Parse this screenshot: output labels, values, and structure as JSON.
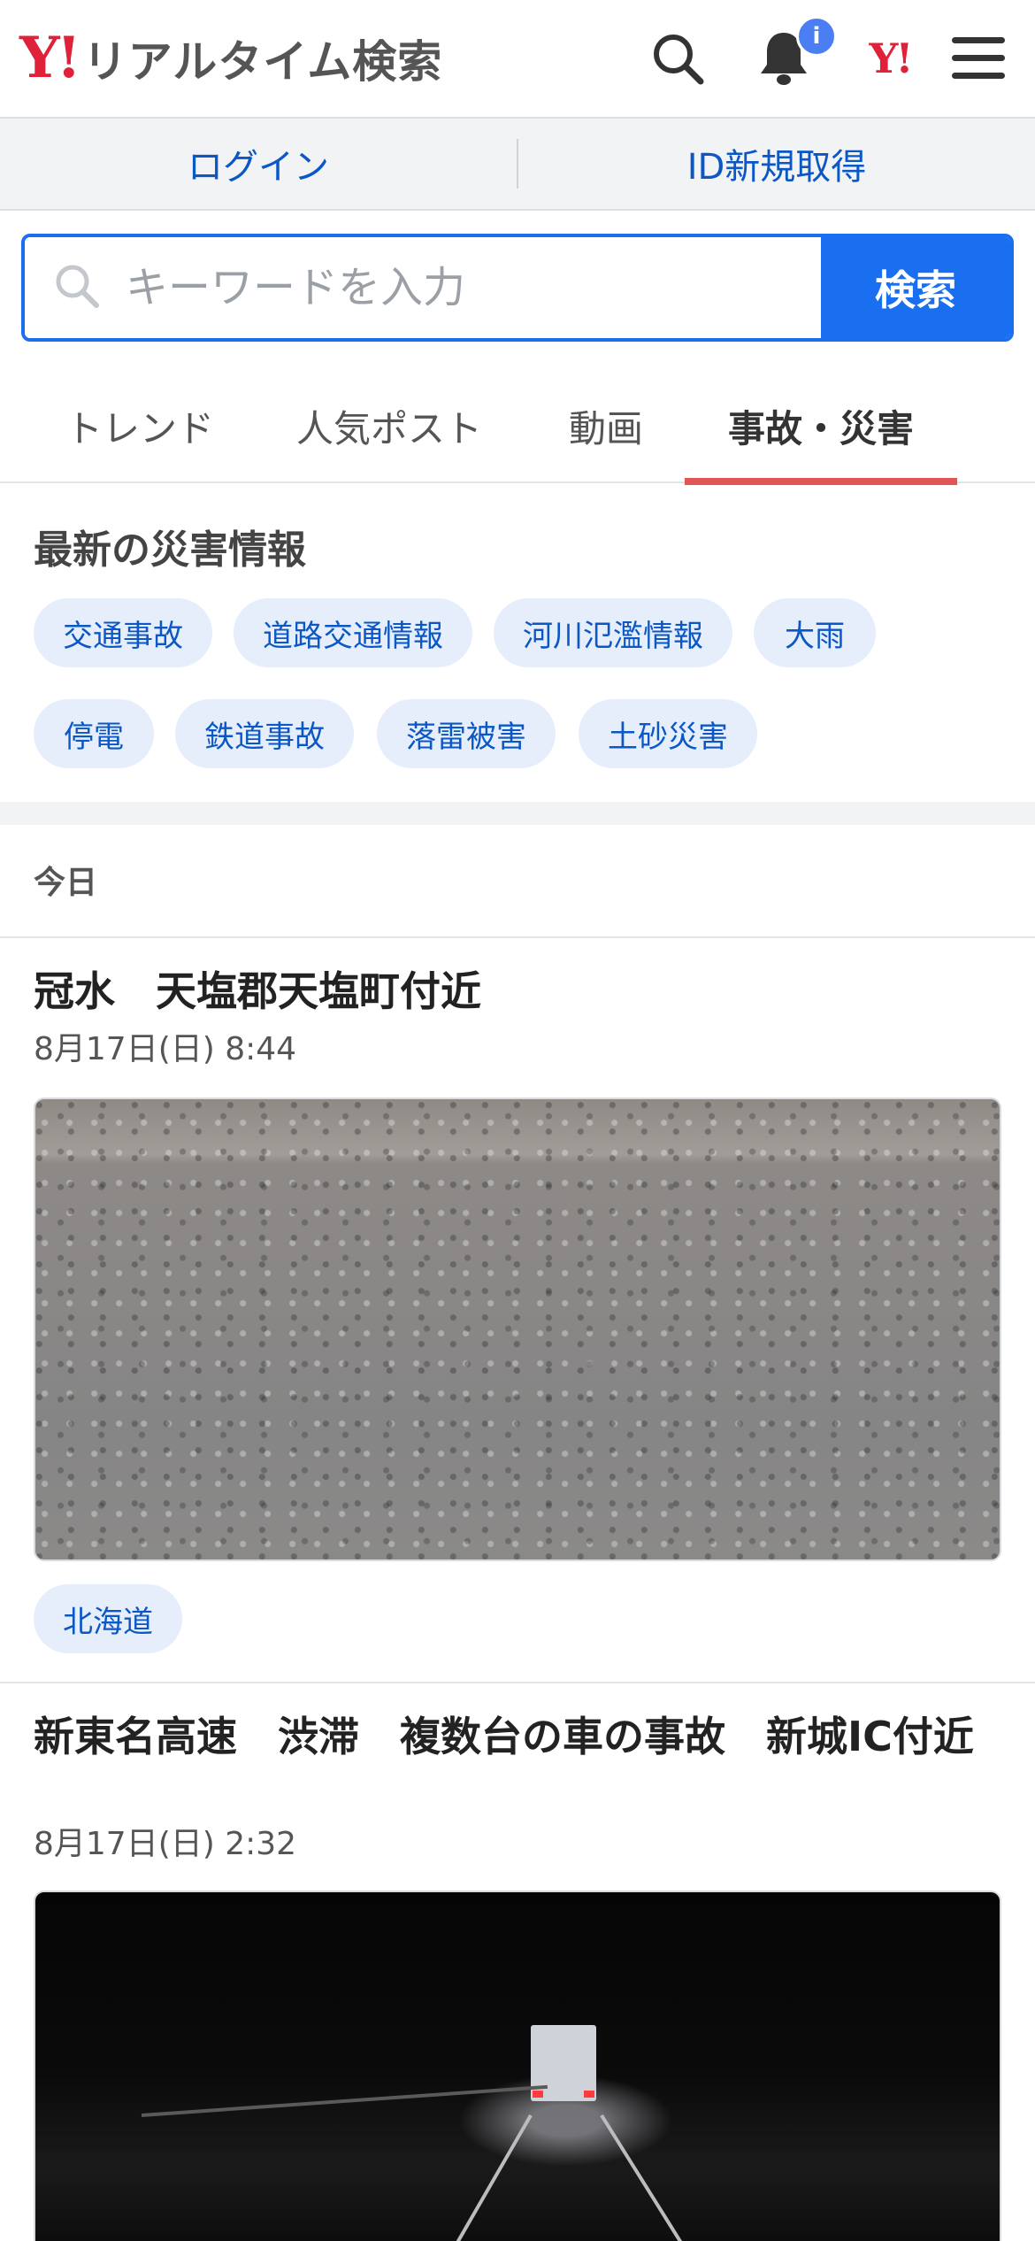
{
  "header": {
    "logo_mark": "Y!",
    "logo_text": "リアルタイム検索",
    "notification_badge": "i",
    "yjapan_mark": "Y!",
    "brand_color": "#e0213a"
  },
  "login_bar": {
    "login_label": "ログイン",
    "register_label": "ID新規取得"
  },
  "search": {
    "placeholder": "キーワードを入力",
    "button_label": "検索",
    "accent_color": "#1a6ff0"
  },
  "tabs": [
    {
      "label": "トレンド"
    },
    {
      "label": "人気ポスト"
    },
    {
      "label": "動画"
    },
    {
      "label": "事故・災害",
      "active": true
    }
  ],
  "disaster_info": {
    "title": "最新の災害情報",
    "chips": [
      "交通事故",
      "道路交通情報",
      "河川氾濫情報",
      "大雨",
      "停電",
      "鉄道事故",
      "落雷被害",
      "土砂災害"
    ]
  },
  "date_header": "今日",
  "articles": [
    {
      "title": "冠水　天塩郡天塩町付近",
      "date": "8月17日(日) 8:44",
      "location": "北海道"
    },
    {
      "title": "新東名高速　渋滞　複数台の車の事故　新城IC付近",
      "date": "8月17日(日) 2:32"
    }
  ]
}
